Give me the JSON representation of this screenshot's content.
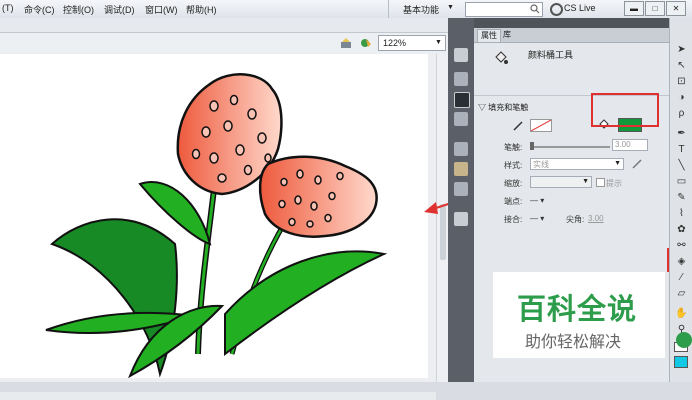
{
  "menu": [
    "(T)",
    "命令(C)",
    "控制(O)",
    "调试(D)",
    "窗口(W)",
    "帮助(H)"
  ],
  "workspace": {
    "label": "基本功能",
    "arrow": "▼"
  },
  "search": {
    "placeholder": ""
  },
  "cs_live": "CS Live",
  "window_controls": [
    "▬",
    "□",
    "✕"
  ],
  "stage": {
    "zoom": "122%"
  },
  "panel": {
    "tabs": [
      "属性",
      "库"
    ],
    "tool_name": "颜料桶工具",
    "section_title": "填充和笔触",
    "stroke_label": "笔触:",
    "stroke_value": "3.00",
    "style_label": "样式:",
    "style_value": "实线",
    "scale_label": "缩放:",
    "hint_label": "提示",
    "cap_label": "端点:",
    "join_label": "接合:",
    "miter_label": "尖角:",
    "miter_value": "3.00",
    "dash": "—",
    "fill_color": "#119a3b"
  },
  "watermark": {
    "title": "百科全说",
    "subtitle": "助你轻松解决"
  },
  "colors": {
    "accent_red": "#e03131",
    "petal": "#f26a4f",
    "leaf": "#22b022",
    "leaf_dark": "#178a26"
  }
}
